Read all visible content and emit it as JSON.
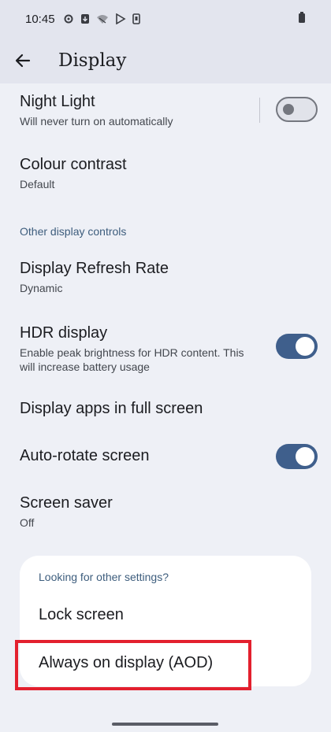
{
  "status": {
    "time": "10:45"
  },
  "app_bar": {
    "title": "Display"
  },
  "settings": {
    "night_light": {
      "title": "Night Light",
      "subtitle": "Will never turn on automatically",
      "enabled": false
    },
    "colour_contrast": {
      "title": "Colour contrast",
      "subtitle": "Default"
    },
    "section_other": "Other display controls",
    "refresh_rate": {
      "title": "Display Refresh Rate",
      "subtitle": "Dynamic"
    },
    "hdr": {
      "title": "HDR display",
      "subtitle": "Enable peak brightness for HDR content. This will increase battery usage",
      "enabled": true
    },
    "full_screen": {
      "title": "Display apps in full screen"
    },
    "auto_rotate": {
      "title": "Auto-rotate screen",
      "enabled": true
    },
    "screen_saver": {
      "title": "Screen saver",
      "subtitle": "Off"
    }
  },
  "other_settings": {
    "header": "Looking for other settings?",
    "items": [
      "Lock screen",
      "Always on display (AOD)"
    ]
  },
  "colors": {
    "toggle_on": "#3f5f8c",
    "highlight": "#e3202e",
    "section_header": "#3d5d7d"
  }
}
